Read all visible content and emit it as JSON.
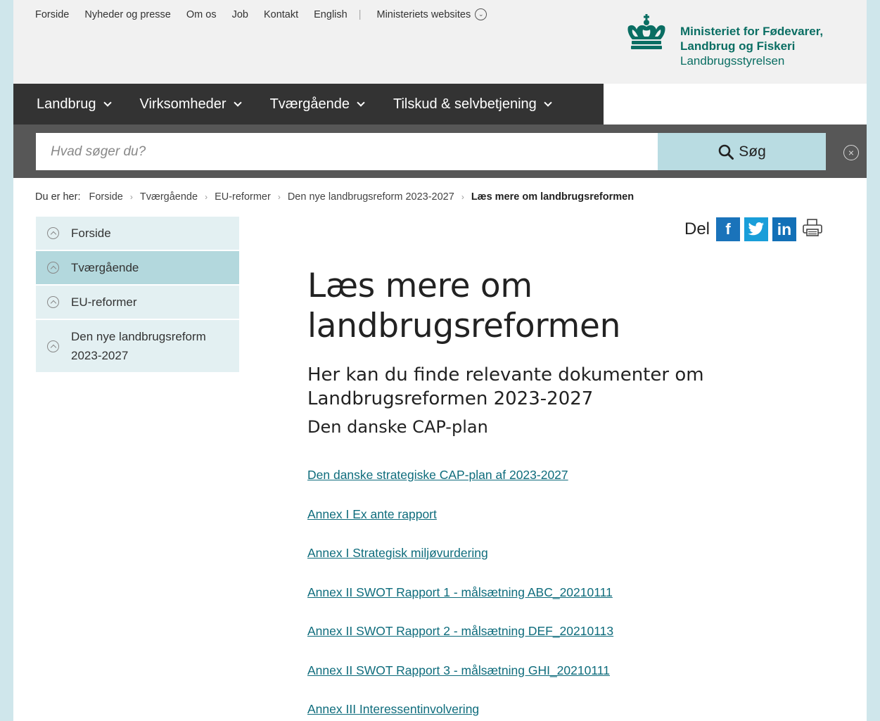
{
  "utility_nav": {
    "items": [
      "Forside",
      "Nyheder og presse",
      "Om os",
      "Job",
      "Kontakt",
      "English"
    ],
    "ministry_sites": "Ministeriets websites"
  },
  "logo": {
    "line1": "Ministeriet for Fødevarer,",
    "line2": "Landbrug og Fiskeri",
    "line3": "Landbrugsstyrelsen"
  },
  "main_nav": {
    "items": [
      "Landbrug",
      "Virksomheder",
      "Tværgående",
      "Tilskud & selvbetjening"
    ]
  },
  "search": {
    "placeholder": "Hvad søger du?",
    "button_label": "Søg"
  },
  "breadcrumb": {
    "label": "Du er her:",
    "items": [
      "Forside",
      "Tværgående",
      "EU-reformer",
      "Den nye landbrugsreform 2023-2027"
    ],
    "current": "Læs mere om landbrugsreformen"
  },
  "left_nav": {
    "items": [
      "Forside",
      "Tværgående",
      "EU-reformer",
      "Den nye landbrugsreform 2023-2027"
    ],
    "active_index": 1
  },
  "share": {
    "label": "Del",
    "icons": [
      "facebook-icon",
      "twitter-icon",
      "linkedin-icon",
      "print-icon"
    ]
  },
  "content": {
    "title": "Læs mere om landbrugsreformen",
    "lead": "Her kan du finde relevante dokumenter om Landbrugsreformen 2023-2027",
    "subheading": "Den danske CAP-plan",
    "links": [
      "Den danske strategiske CAP-plan af 2023-2027",
      "Annex I Ex ante rapport",
      "Annex I Strategisk miljøvurdering",
      "Annex II SWOT Rapport 1 - målsætning ABC_20210111",
      "Annex II SWOT Rapport 2 - målsætning DEF_20210113",
      "Annex II SWOT Rapport 3 - målsætning GHI_20210111",
      "Annex III Interessentinvolvering"
    ]
  },
  "colors": {
    "page_background": "#cfe6eb",
    "top_background": "#f1f1f1",
    "nav_background": "#333333",
    "search_bar_background": "#575757",
    "search_button": "#b9dce2",
    "brand_green": "#0a6e63",
    "link": "#0e6c7c",
    "left_nav_item": "#e3f0f2",
    "left_nav_active": "#b3d8dd"
  }
}
